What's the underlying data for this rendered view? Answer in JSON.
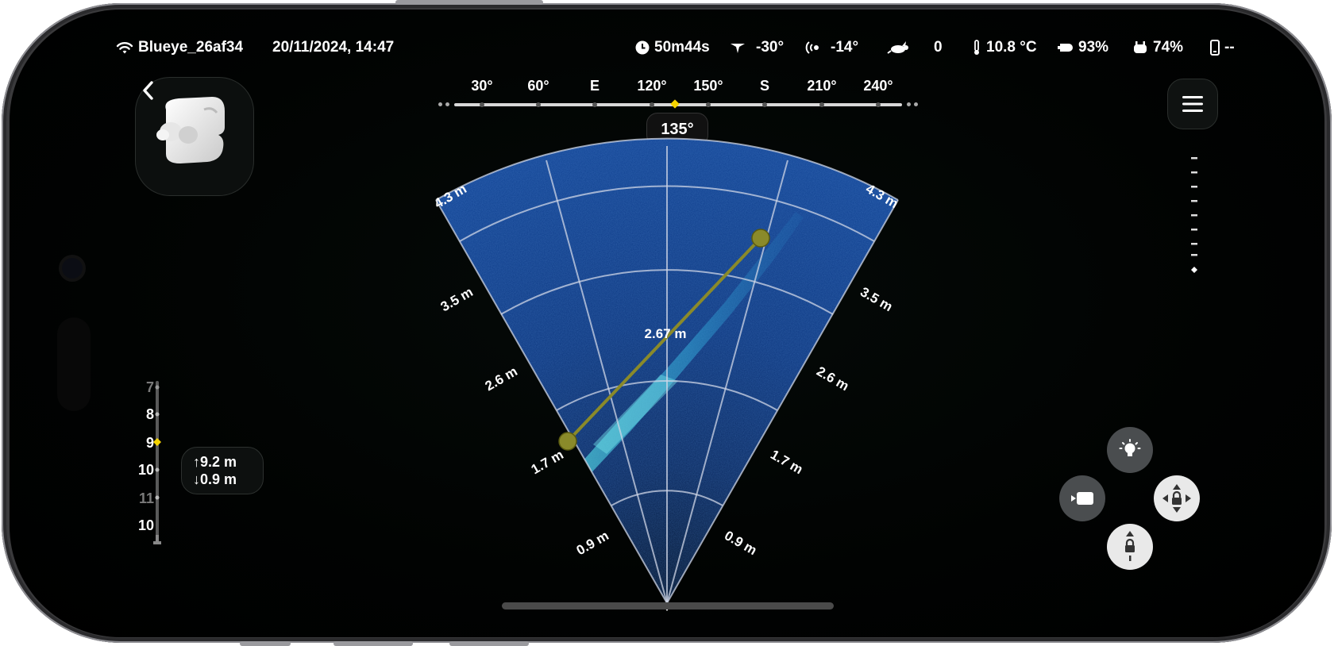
{
  "status": {
    "device_name": "Blueye_26af34",
    "datetime": "20/11/2024, 14:47",
    "dive_time": "50m44s",
    "tilt": "-30°",
    "roll": "-14°",
    "speed": "0",
    "temperature": "10.8 °C",
    "drone_battery": "93%",
    "controller_battery": "74%",
    "phone": "--"
  },
  "compass": {
    "labels": [
      "30°",
      "60°",
      "E",
      "120°",
      "150°",
      "S",
      "210°",
      "240°"
    ],
    "heading": "135°"
  },
  "sonar": {
    "range_labels": [
      "4.3 m",
      "3.5 m",
      "2.6 m",
      "1.7 m",
      "0.9 m"
    ],
    "measurement": "2.67 m"
  },
  "depth": {
    "scale": [
      "7",
      "8",
      "9",
      "10",
      "11",
      "10"
    ],
    "up": "↑9.2 m",
    "down": "↓0.9 m"
  },
  "colors": {
    "accent": "#f5d400",
    "sonar_blue": "#0b3a8c",
    "measure_line": "#8a8a2a"
  },
  "icons": {
    "back": "chevron-left-icon",
    "menu": "hamburger-icon",
    "light": "lightbulb-icon",
    "camera": "video-camera-icon",
    "lock_move": "position-lock-icon",
    "lock_depth": "depth-lock-icon"
  }
}
